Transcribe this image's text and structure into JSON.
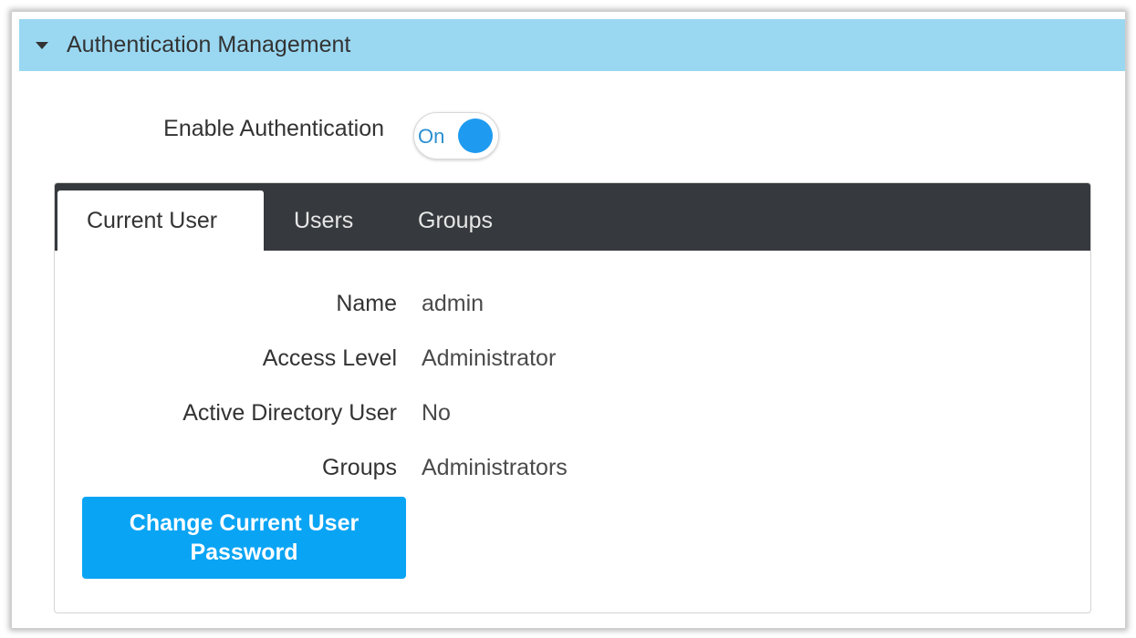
{
  "panel": {
    "title": "Authentication Management",
    "expanded": true,
    "caret_icon": "caret-down-icon"
  },
  "auth_toggle": {
    "label": "Enable Authentication",
    "state_text": "On",
    "enabled": true,
    "knob_color": "#1e9bf0"
  },
  "tabs": [
    {
      "label": "Current User",
      "active": true
    },
    {
      "label": "Users",
      "active": false
    },
    {
      "label": "Groups",
      "active": false
    }
  ],
  "current_user": {
    "fields": [
      {
        "label": "Name",
        "value": "admin"
      },
      {
        "label": "Access Level",
        "value": "Administrator"
      },
      {
        "label": "Active Directory User",
        "value": "No"
      },
      {
        "label": "Groups",
        "value": "Administrators"
      }
    ],
    "change_password_label": "Change Current User Password"
  },
  "colors": {
    "header_bg": "#9ad8f2",
    "tab_bar_bg": "#363a3e",
    "primary_button": "#0aa4f4"
  }
}
